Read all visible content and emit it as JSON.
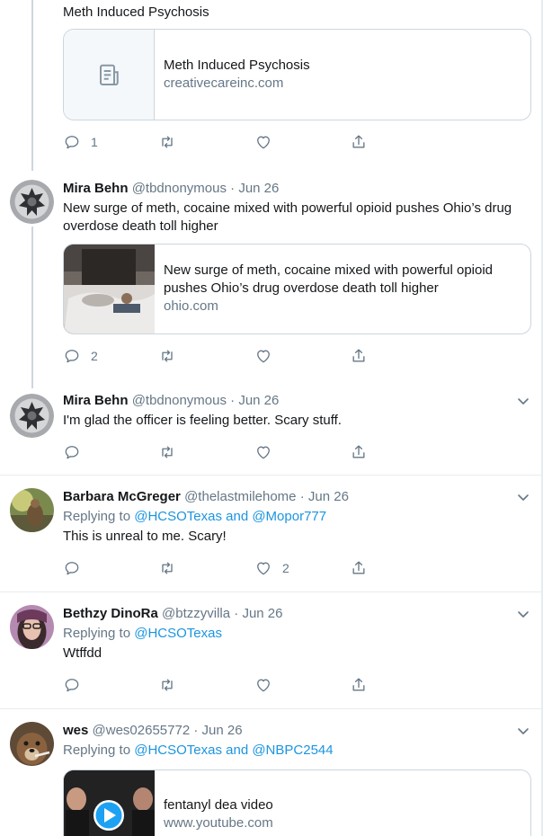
{
  "tweets": [
    {
      "text": "Meth Induced Psychosis",
      "card": {
        "title": "Meth Induced Psychosis",
        "domain": "creativecareinc.com",
        "thumb_icon": "article-icon"
      },
      "actions": {
        "reply_count": "1",
        "retweet_count": "",
        "like_count": ""
      }
    },
    {
      "name": "Mira Behn",
      "handle": "@tbdnonymous",
      "sep": "·",
      "date": "Jun 26",
      "text": "New surge of meth, cocaine mixed with powerful opioid pushes Ohio’s drug overdose death toll higher",
      "card": {
        "title": "New surge of meth, cocaine mixed with powerful opioid pushes Ohio’s drug overdose death toll higher",
        "domain": "ohio.com"
      },
      "actions": {
        "reply_count": "2",
        "retweet_count": "",
        "like_count": ""
      }
    },
    {
      "name": "Mira Behn",
      "handle": "@tbdnonymous",
      "sep": "·",
      "date": "Jun 26",
      "text": "I'm glad the officer is feeling better. Scary stuff.",
      "actions": {
        "reply_count": "",
        "retweet_count": "",
        "like_count": ""
      }
    },
    {
      "name": "Barbara McGreger",
      "handle": "@thelastmilehome",
      "sep": "·",
      "date": "Jun 26",
      "replying_prefix": "Replying to ",
      "replying_to": "@HCSOTexas and @Mopor777",
      "text": "This is unreal to me. Scary!",
      "actions": {
        "reply_count": "",
        "retweet_count": "",
        "like_count": "2"
      }
    },
    {
      "name": "Bethzy DinoRa",
      "handle": "@btzzyvilla",
      "sep": "·",
      "date": "Jun 26",
      "replying_prefix": "Replying to ",
      "replying_to": "@HCSOTexas",
      "text": "Wtffdd",
      "actions": {
        "reply_count": "",
        "retweet_count": "",
        "like_count": ""
      }
    },
    {
      "name": "wes",
      "handle": "@wes02655772",
      "sep": "·",
      "date": "Jun 26",
      "replying_prefix": "Replying to ",
      "replying_to": "@HCSOTexas and @NBPC2544",
      "card": {
        "title": "fentanyl dea video",
        "domain": "www.youtube.com"
      }
    }
  ],
  "colors": {
    "accent": "#1b95e0",
    "muted": "#657786",
    "border": "#e6ecf0",
    "card_border": "#ccd6dd"
  }
}
